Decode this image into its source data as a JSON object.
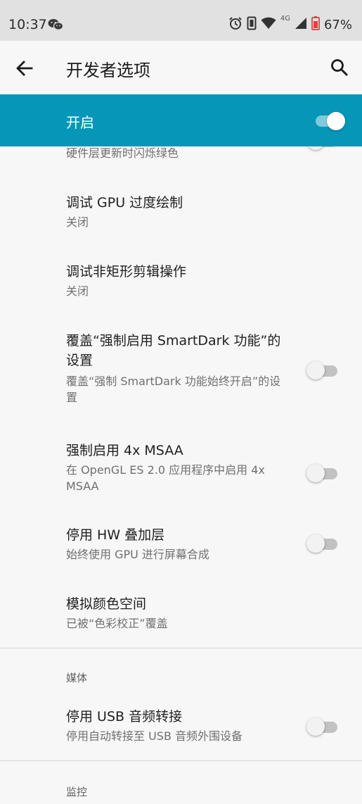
{
  "status_bar": {
    "time": "10:37",
    "network": "4G",
    "battery": "67%",
    "icons": [
      "wechat-icon",
      "alarm-icon",
      "vibrate-icon",
      "wifi-icon",
      "signal-icon",
      "battery-icon"
    ]
  },
  "app_bar": {
    "title": "开发者选项",
    "back_icon": "arrow-back-icon",
    "search_icon": "search-icon"
  },
  "master_switch": {
    "label": "开启",
    "checked": true
  },
  "colors": {
    "accent": "#0596b8",
    "status_bar_bg": "#e1e1e1",
    "page_bg": "#f7f7f7"
  },
  "preferences": [
    {
      "summary": "硬件层更新时闪烁绿色",
      "has_toggle": true,
      "checked": false
    },
    {
      "title": "调试 GPU 过度绘制",
      "summary": "关闭",
      "has_toggle": false
    },
    {
      "title": "调试非矩形剪辑操作",
      "summary": "关闭",
      "has_toggle": false
    },
    {
      "title": "覆盖“强制启用 SmartDark 功能”的设置",
      "summary": "覆盖“强制 SmartDark 功能始终开启”的设置",
      "has_toggle": true,
      "checked": false
    },
    {
      "title": "强制启用 4x MSAA",
      "summary": "在 OpenGL ES 2.0 应用程序中启用 4x MSAA",
      "has_toggle": true,
      "checked": false
    },
    {
      "title": "停用 HW 叠加层",
      "summary": "始终使用 GPU 进行屏幕合成",
      "has_toggle": true,
      "checked": false
    },
    {
      "title": "模拟颜色空间",
      "summary": "已被“色彩校正”覆盖",
      "has_toggle": false
    }
  ],
  "categories": {
    "media": "媒体",
    "monitoring": "监控"
  },
  "media_preferences": [
    {
      "title": "停用 USB 音频转接",
      "summary": "停用自动转接至 USB 音频外围设备",
      "has_toggle": true,
      "checked": false
    }
  ]
}
